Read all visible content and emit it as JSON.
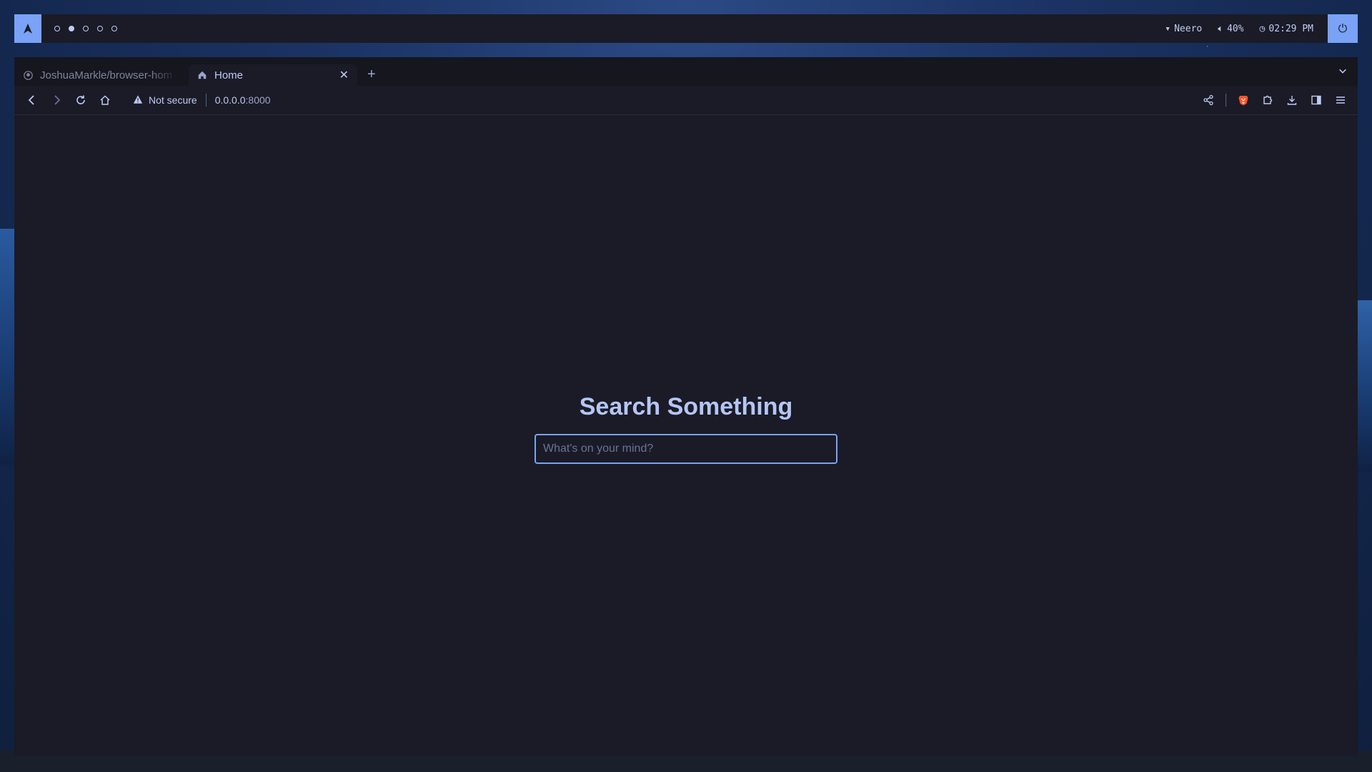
{
  "desktop": {
    "workspaces": [
      {
        "active": false
      },
      {
        "active": true
      },
      {
        "active": false
      },
      {
        "active": false
      },
      {
        "active": false
      }
    ],
    "status": {
      "network": "Neero",
      "volume": "40%",
      "clock": "02:29 PM"
    },
    "colors": {
      "accent": "#7aa2f7",
      "bar": "#1a1b26"
    }
  },
  "browser": {
    "tabs": [
      {
        "title": "JoshuaMarkle/browser-hom",
        "favicon": "github-icon",
        "active": false
      },
      {
        "title": "Home",
        "favicon": "home-icon",
        "active": true
      }
    ],
    "url": {
      "security": "Not secure",
      "host": "0.0.0.0",
      "port": ":8000"
    }
  },
  "page": {
    "heading": "Search Something",
    "search_placeholder": "What's on your mind?",
    "search_value": ""
  }
}
